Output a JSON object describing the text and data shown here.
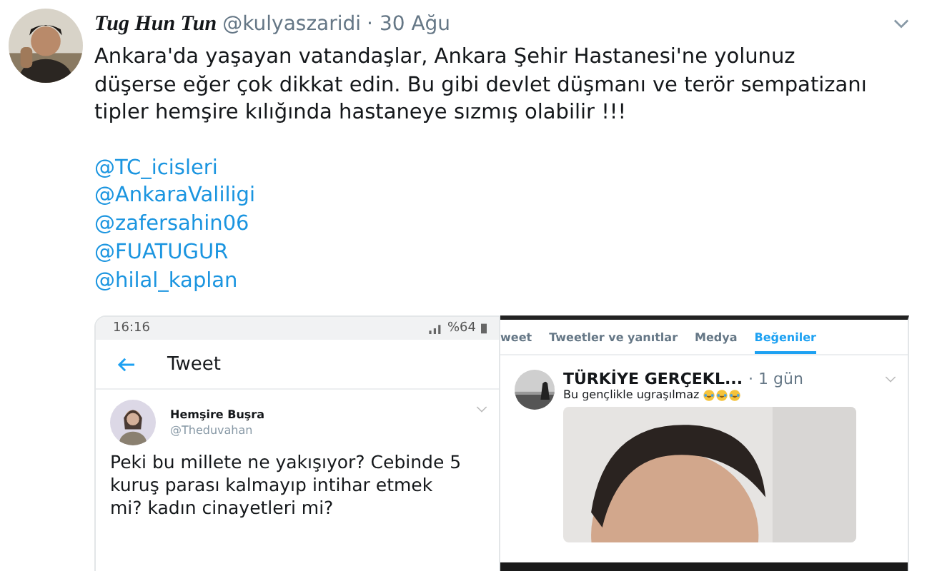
{
  "tweet": {
    "author": "Tug Hun Tun",
    "handle": "@kulyaszaridi",
    "date": "· 30 Ağu",
    "text": "Ankara'da yaşayan vatandaşlar, Ankara Şehir Hastanesi'ne yolunuz düşerse eğer çok dikkat edin. Bu gibi devlet düşmanı ve terör sempatizanı tipler hemşire kılığında hastaneye sızmış olabilir !!!",
    "mentions": [
      "@TC_icisleri",
      "@AnkaraValiligi",
      "@zafersahin06",
      "@FUATUGUR",
      "@hilal_kaplan"
    ]
  },
  "left_shot": {
    "time": "16:16",
    "battery": "%64",
    "title": "Tweet",
    "author": "Hemşire Buşra",
    "handle": "@Theduvahan",
    "text": "Peki bu millete ne yakışıyor? Cebinde 5 kuruş parası kalmayıp intihar etmek mi? kadın cinayetleri mi?"
  },
  "right_shot": {
    "tabs": [
      {
        "label": "weet",
        "selected": false
      },
      {
        "label": "Tweetler ve yanıtlar",
        "selected": false
      },
      {
        "label": "Medya",
        "selected": false
      },
      {
        "label": "Beğeniler",
        "selected": true
      }
    ],
    "author": "TÜRKİYE GERÇEKL...",
    "date": "· 1 gün",
    "text": "Bu gençlikle ugraşılmaz"
  }
}
